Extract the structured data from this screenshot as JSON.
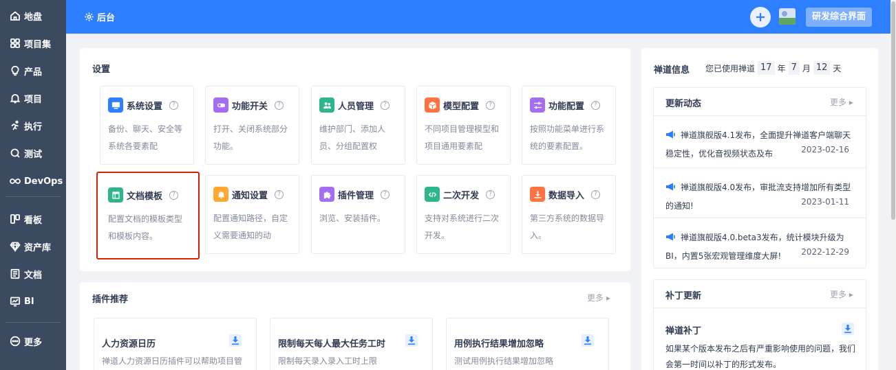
{
  "sidebar": {
    "items": [
      {
        "label": "地盘",
        "icon": "home-icon"
      },
      {
        "label": "项目集",
        "icon": "grid-icon"
      },
      {
        "label": "产品",
        "icon": "lightbulb-icon"
      },
      {
        "label": "项目",
        "icon": "bell-icon"
      },
      {
        "label": "执行",
        "icon": "run-icon"
      },
      {
        "label": "测试",
        "icon": "test-icon"
      },
      {
        "label": "DevOps",
        "icon": "infinity-icon"
      },
      {
        "label": "看板",
        "icon": "kanban-icon"
      },
      {
        "label": "资产库",
        "icon": "diamond-icon"
      },
      {
        "label": "文档",
        "icon": "doc-icon"
      },
      {
        "label": "BI",
        "icon": "chart-icon"
      },
      {
        "label": "更多",
        "icon": "more-icon"
      }
    ]
  },
  "header": {
    "back_label": "后台",
    "switch_label": "研发综合界面"
  },
  "settings": {
    "title": "设置",
    "cards": [
      {
        "title": "系统设置",
        "desc": "备份、聊天、安全等系统各要素配",
        "color": "#2e7fff",
        "icon": "monitor-icon"
      },
      {
        "title": "功能开关",
        "desc": "打开、关闭系统部分功能。",
        "color": "#a56df2",
        "icon": "toggle-icon"
      },
      {
        "title": "人员管理",
        "desc": "维护部门、添加人员、分组配置权",
        "color": "#2eb58c",
        "icon": "people-icon"
      },
      {
        "title": "模型配置",
        "desc": "不同项目管理模型和项目通用要素配",
        "color": "#ff7340",
        "icon": "cube-icon"
      },
      {
        "title": "功能配置",
        "desc": "按照功能菜单进行系统的要素配置。",
        "color": "#a56df2",
        "icon": "sliders-icon"
      },
      {
        "title": "文档模板",
        "desc": "配置文档的模板类型和模板内容。",
        "color": "#2eb58c",
        "icon": "template-icon"
      },
      {
        "title": "通知设置",
        "desc": "配置通知路径，自定义需要通知的动",
        "color": "#ffa733",
        "icon": "notify-bell-icon"
      },
      {
        "title": "插件管理",
        "desc": "浏览、安装插件。",
        "color": "#a56df2",
        "icon": "puzzle-icon"
      },
      {
        "title": "二次开发",
        "desc": "支持对系统进行二次开发。",
        "color": "#2eb58c",
        "icon": "code-icon"
      },
      {
        "title": "数据导入",
        "desc": "第三方系统的数据导入。",
        "color": "#ff7340",
        "icon": "import-icon"
      }
    ]
  },
  "plugins": {
    "title": "插件推荐",
    "more": "更多",
    "items": [
      {
        "title": "人力资源日历",
        "desc": "禅道人力资源日历插件可以帮助项目管"
      },
      {
        "title": "限制每天每人最大任务工时",
        "desc": "限制每天录入录入工时上限"
      },
      {
        "title": "用例执行结果增加忽略",
        "desc": "测试用例执行结果增加忽略"
      }
    ]
  },
  "zentao_info": {
    "title": "禅道信息",
    "usage_prefix": "您已使用禅道",
    "years": "17",
    "year_unit": "年",
    "months": "7",
    "month_unit": "月",
    "days": "12",
    "day_unit": "天"
  },
  "updates": {
    "title": "更新动态",
    "more": "更多",
    "items": [
      {
        "text": "禅道旗舰版4.1发布，全面提升禅道客户端聊天稳定性，优化音视频状态及布",
        "date": "2023-02-16"
      },
      {
        "text": "禅道旗舰版4.0发布，审批流支持增加所有类型的通知!",
        "date": "2023-01-11"
      },
      {
        "text": "禅道旗舰版4.0.beta3发布，统计模块升级为BI，内置5张宏观管理维度大屏!",
        "date": "2022-12-29"
      }
    ]
  },
  "patches": {
    "title": "补丁更新",
    "more": "更多",
    "item_title": "禅道补丁",
    "item_desc": "如果某个版本发布之后有严重影响使用的问题，我们会第一时间以补丁的形式发布。"
  },
  "colors": {
    "header_bg": "#2e7fff",
    "sidebar_bg": "#3b4a60",
    "selection_border": "#d81e06"
  }
}
